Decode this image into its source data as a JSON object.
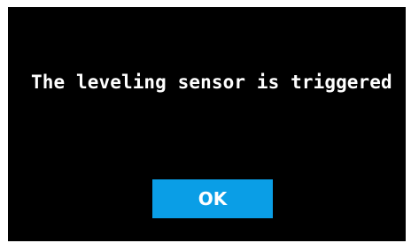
{
  "dialog": {
    "message": "The leveling sensor is triggered",
    "ok_label": "OK"
  },
  "colors": {
    "background": "#000000",
    "text": "#ffffff",
    "button": "#0a9ee6"
  }
}
